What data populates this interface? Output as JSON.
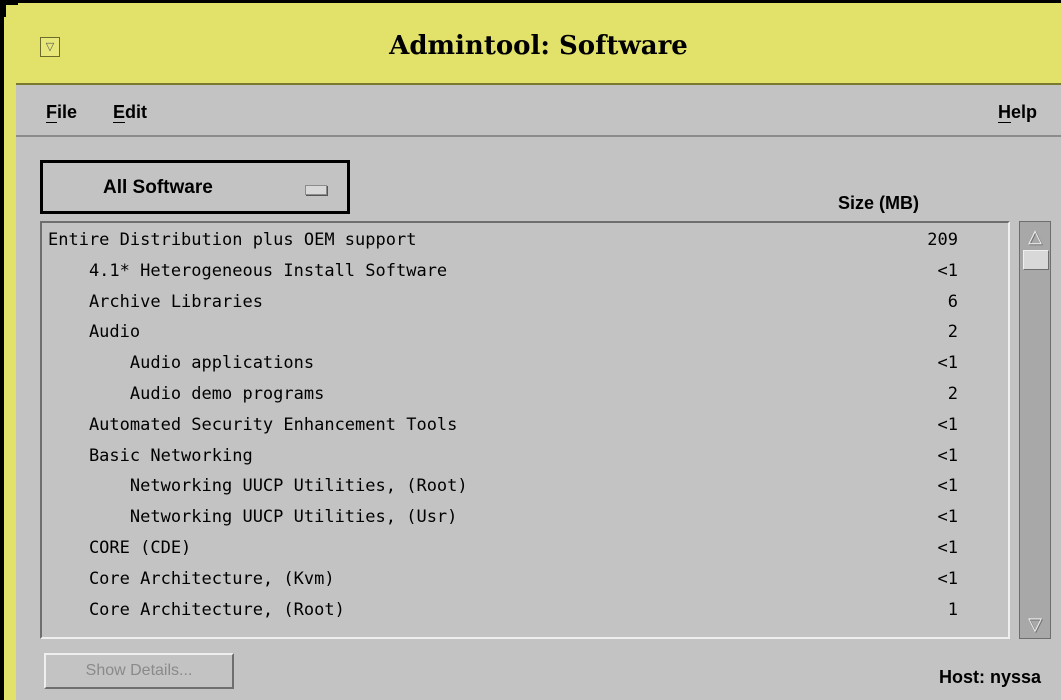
{
  "window": {
    "title": "Admintool: Software",
    "menu_button_glyph": "▽",
    "accent": "#e2e26a",
    "panel_bg": "#c3c3c3"
  },
  "menubar": {
    "file_first": "F",
    "file_rest": "ile",
    "edit_first": "E",
    "edit_rest": "dit",
    "help_first": "H",
    "help_rest": "elp"
  },
  "filter": {
    "selected": "All Software"
  },
  "list": {
    "size_header": "Size (MB)",
    "rows": [
      {
        "name": "Entire Distribution plus OEM support",
        "size": "209"
      },
      {
        "name": "    4.1* Heterogeneous Install Software",
        "size": "<1"
      },
      {
        "name": "    Archive Libraries",
        "size": "6"
      },
      {
        "name": "    Audio",
        "size": "2"
      },
      {
        "name": "        Audio applications",
        "size": "<1"
      },
      {
        "name": "        Audio demo programs",
        "size": "2"
      },
      {
        "name": "    Automated Security Enhancement Tools",
        "size": "<1"
      },
      {
        "name": "    Basic Networking",
        "size": "<1"
      },
      {
        "name": "        Networking UUCP Utilities, (Root)",
        "size": "<1"
      },
      {
        "name": "        Networking UUCP Utilities, (Usr)",
        "size": "<1"
      },
      {
        "name": "    CORE (CDE)",
        "size": "<1"
      },
      {
        "name": "    Core Architecture, (Kvm)",
        "size": "<1"
      },
      {
        "name": "    Core Architecture, (Root)",
        "size": "1"
      }
    ]
  },
  "scrollbar": {
    "up_glyph": "△",
    "down_glyph": "▽"
  },
  "footer": {
    "details_label": "Show Details...",
    "host_label": "Host: nyssa"
  }
}
